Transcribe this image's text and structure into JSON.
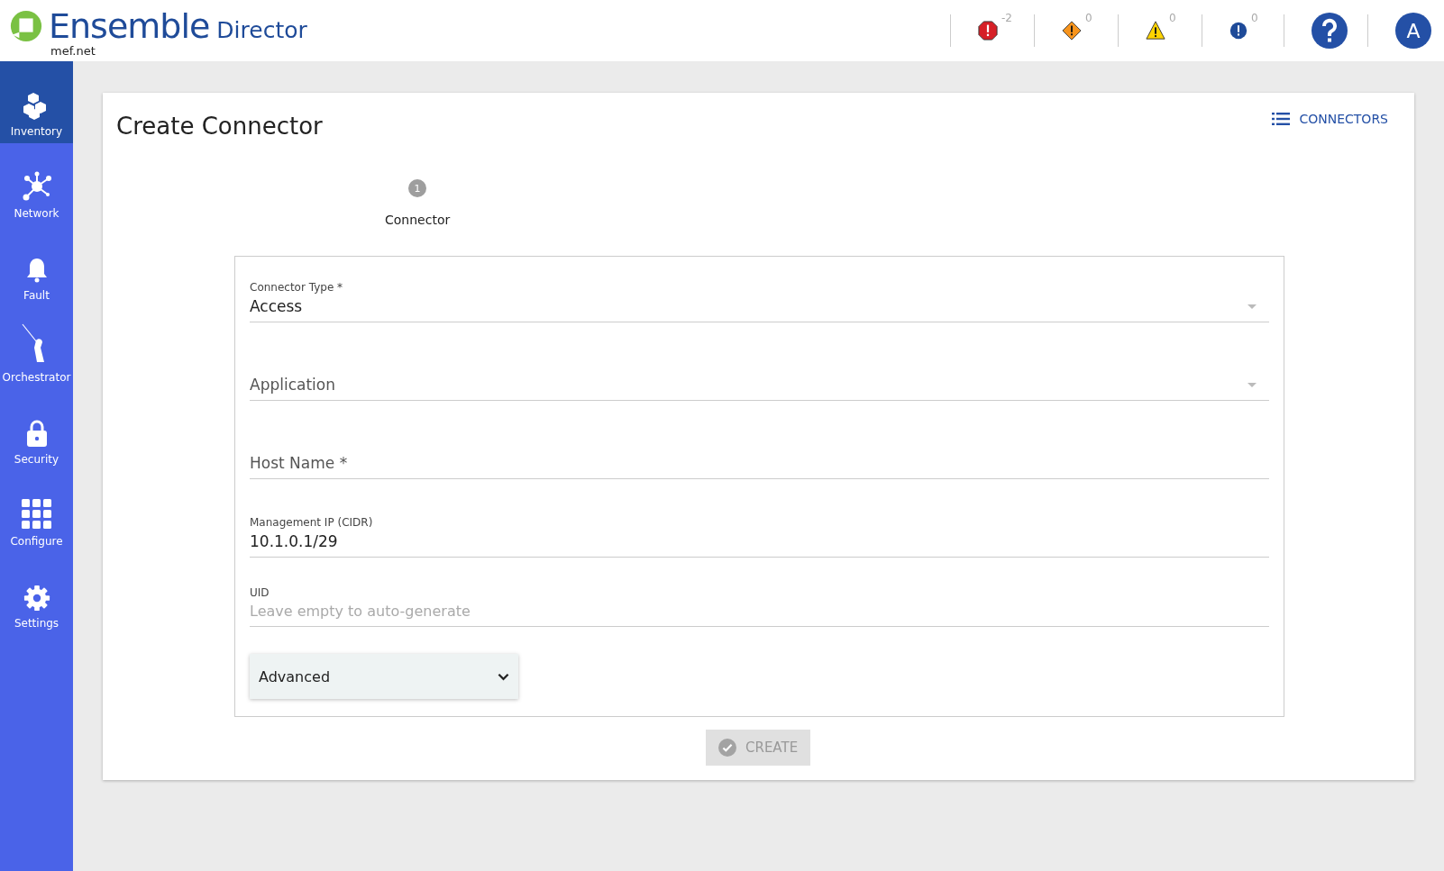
{
  "header": {
    "brand": "Ensemble",
    "product": "Director",
    "domain": "mef.net",
    "alerts": [
      {
        "kind": "critical",
        "count": "-2"
      },
      {
        "kind": "major",
        "count": "0"
      },
      {
        "kind": "minor",
        "count": "0"
      },
      {
        "kind": "info",
        "count": "0"
      }
    ],
    "avatar": "A"
  },
  "sidebar": {
    "items": [
      {
        "label": "Inventory",
        "selected": true
      },
      {
        "label": "Network",
        "selected": false
      },
      {
        "label": "Fault",
        "selected": false
      },
      {
        "label": "Orchestrator",
        "selected": false
      },
      {
        "label": "Security",
        "selected": false
      },
      {
        "label": "Configure",
        "selected": false
      },
      {
        "label": "Settings",
        "selected": false
      }
    ]
  },
  "page": {
    "title": "Create Connector",
    "list_link": "CONNECTORS",
    "steps": [
      {
        "number": "1",
        "label": "Connector"
      }
    ],
    "fields": [
      {
        "kind": "select",
        "label": "Connector Type *",
        "value": "Access"
      },
      {
        "kind": "select",
        "placeholder": "Application"
      },
      {
        "kind": "text",
        "placeholder": "Host Name *"
      },
      {
        "kind": "text",
        "label": "Management IP (CIDR)",
        "value": "10.1.0.1/29"
      },
      {
        "kind": "text",
        "label": "UID",
        "placeholder": "Leave empty to auto-generate"
      }
    ],
    "advanced": {
      "label": "Advanced",
      "expanded": false
    },
    "create_button": {
      "label": "CREATE",
      "disabled": true
    }
  }
}
